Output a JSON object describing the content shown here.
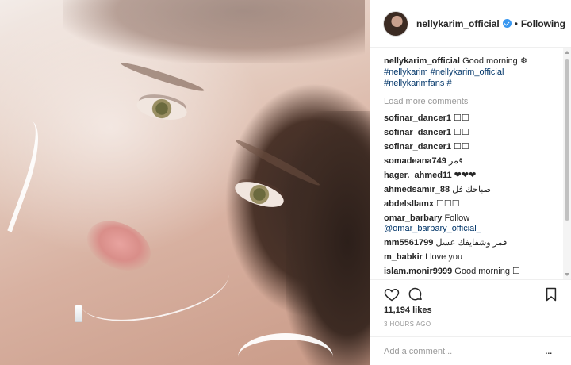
{
  "post": {
    "username": "nellykarim_official",
    "follow_label": "Following",
    "dot": "•",
    "caption_text": "Good morning ❄",
    "caption_tags": [
      "#nellykarim",
      "#nellykarim_official",
      "#nellykarimfans",
      "#"
    ],
    "load_more": "Load more comments",
    "comments": [
      {
        "user": "sofinar_dancer1",
        "text": "☐☐"
      },
      {
        "user": "sofinar_dancer1",
        "text": "☐☐"
      },
      {
        "user": "sofinar_dancer1",
        "text": "☐☐"
      },
      {
        "user": "somadeana749",
        "text": "قمر"
      },
      {
        "user": "hager._ahmed11",
        "text": "❤❤❤"
      },
      {
        "user": "ahmedsamir_88",
        "text": "صباحك فل"
      },
      {
        "user": "abdelsllamx",
        "text": "☐☐☐"
      },
      {
        "user": "omar_barbary",
        "text": "Follow",
        "mention": "@omar_barbary_official_"
      },
      {
        "user": "mm5561799",
        "text": "قمر وشفايفك عسل"
      },
      {
        "user": "m_babkir",
        "text": "I love you"
      },
      {
        "user": "islam.monir9999",
        "text": "Good morning ☐"
      }
    ],
    "likes": "11,194 likes",
    "time": "3 HOURS AGO",
    "add_comment_placeholder": "Add a comment...",
    "more_icon": "..."
  },
  "colors": {
    "link": "#003569",
    "verified": "#3897f0",
    "muted": "#999999"
  },
  "icons": [
    "heart-icon",
    "comment-icon",
    "bookmark-icon",
    "verified-icon",
    "more-icon"
  ]
}
